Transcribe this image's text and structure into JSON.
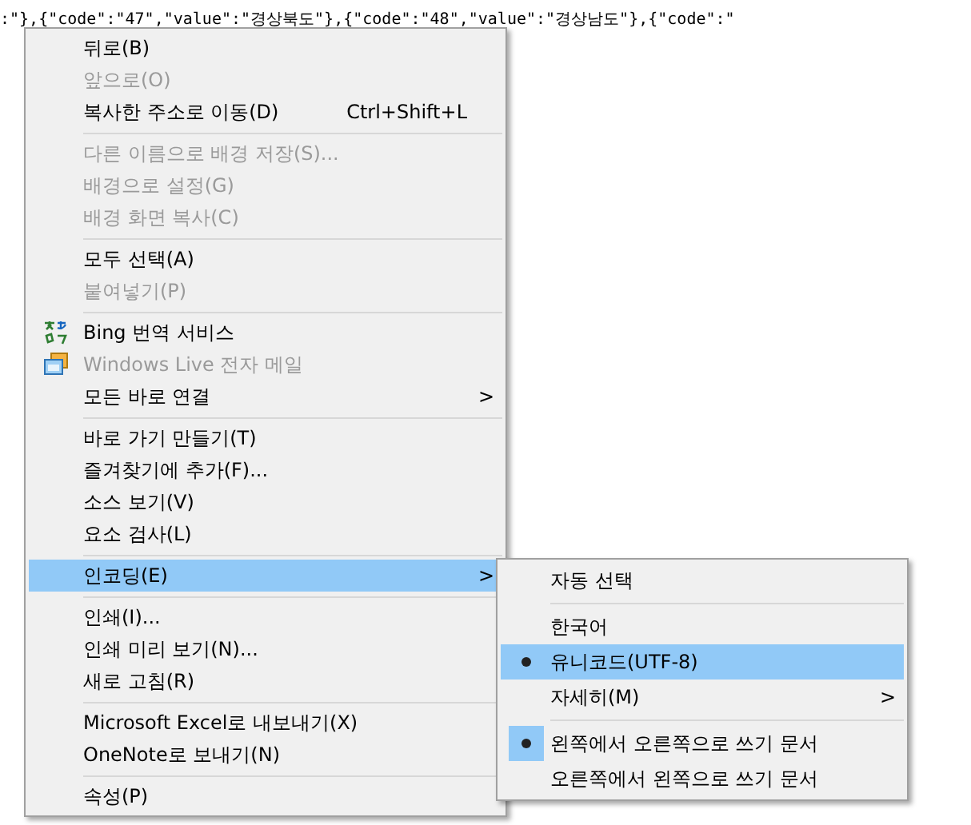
{
  "page_text": ":\"},{\"code\":\"47\",\"value\":\"경상북도\"},{\"code\":\"48\",\"value\":\"경상남도\"},{\"code\":\"",
  "context_menu": {
    "items": [
      {
        "kind": "item",
        "label": "뒤로(B)",
        "disabled": false,
        "selected": false
      },
      {
        "kind": "item",
        "label": "앞으로(O)",
        "disabled": true,
        "selected": false
      },
      {
        "kind": "item",
        "label": "복사한 주소로 이동(D)",
        "shortcut": "Ctrl+Shift+L",
        "disabled": false,
        "selected": false
      },
      {
        "kind": "separator"
      },
      {
        "kind": "item",
        "label": "다른 이름으로 배경 저장(S)...",
        "disabled": true,
        "selected": false
      },
      {
        "kind": "item",
        "label": "배경으로 설정(G)",
        "disabled": true,
        "selected": false
      },
      {
        "kind": "item",
        "label": "배경 화면 복사(C)",
        "disabled": true,
        "selected": false
      },
      {
        "kind": "separator"
      },
      {
        "kind": "item",
        "label": "모두 선택(A)",
        "disabled": false,
        "selected": false
      },
      {
        "kind": "item",
        "label": "붙여넣기(P)",
        "disabled": true,
        "selected": false
      },
      {
        "kind": "separator"
      },
      {
        "kind": "icon_item",
        "label": "Bing 번역 서비스",
        "disabled": false,
        "selected": false
      },
      {
        "kind": "icon_item",
        "label": "Windows Live 전자 메일",
        "disabled": true,
        "selected": false
      },
      {
        "kind": "item",
        "label": "모든 바로 연결",
        "submenu": ">",
        "disabled": false,
        "selected": false
      },
      {
        "kind": "separator"
      },
      {
        "kind": "item",
        "label": "바로 가기 만들기(T)",
        "disabled": false,
        "selected": false
      },
      {
        "kind": "item",
        "label": "즐겨찾기에 추가(F)...",
        "disabled": false,
        "selected": false
      },
      {
        "kind": "item",
        "label": "소스 보기(V)",
        "disabled": false,
        "selected": false
      },
      {
        "kind": "item",
        "label": "요소 검사(L)",
        "disabled": false,
        "selected": false
      },
      {
        "kind": "separator"
      },
      {
        "kind": "item",
        "label": "인코딩(E)",
        "submenu": ">",
        "disabled": false,
        "selected": true
      },
      {
        "kind": "separator"
      },
      {
        "kind": "item",
        "label": "인쇄(I)...",
        "disabled": false,
        "selected": false
      },
      {
        "kind": "item",
        "label": "인쇄 미리 보기(N)...",
        "disabled": false,
        "selected": false
      },
      {
        "kind": "item",
        "label": "새로 고침(R)",
        "disabled": false,
        "selected": false
      },
      {
        "kind": "separator"
      },
      {
        "kind": "item",
        "label": "Microsoft Excel로 내보내기(X)",
        "disabled": false,
        "selected": false
      },
      {
        "kind": "item",
        "label": "OneNote로 보내기(N)",
        "disabled": false,
        "selected": false
      },
      {
        "kind": "separator"
      },
      {
        "kind": "item",
        "label": "속성(P)",
        "disabled": false,
        "selected": false
      }
    ]
  },
  "encoding_submenu": {
    "items": [
      {
        "kind": "item",
        "label": "자동 선택",
        "checked": false,
        "selected": false
      },
      {
        "kind": "separator"
      },
      {
        "kind": "item",
        "label": "한국어",
        "checked": false,
        "selected": false
      },
      {
        "kind": "item",
        "label": "유니코드(UTF-8)",
        "checked": true,
        "selected": true
      },
      {
        "kind": "item",
        "label": "자세히(M)",
        "submenu": ">",
        "checked": false,
        "selected": false
      },
      {
        "kind": "separator"
      },
      {
        "kind": "item",
        "label": "왼쪽에서 오른쪽으로 쓰기 문서",
        "checked": true,
        "selected": false
      },
      {
        "kind": "item",
        "label": "오른쪽에서 왼쪽으로 쓰기 문서",
        "checked": false,
        "selected": false
      }
    ]
  }
}
